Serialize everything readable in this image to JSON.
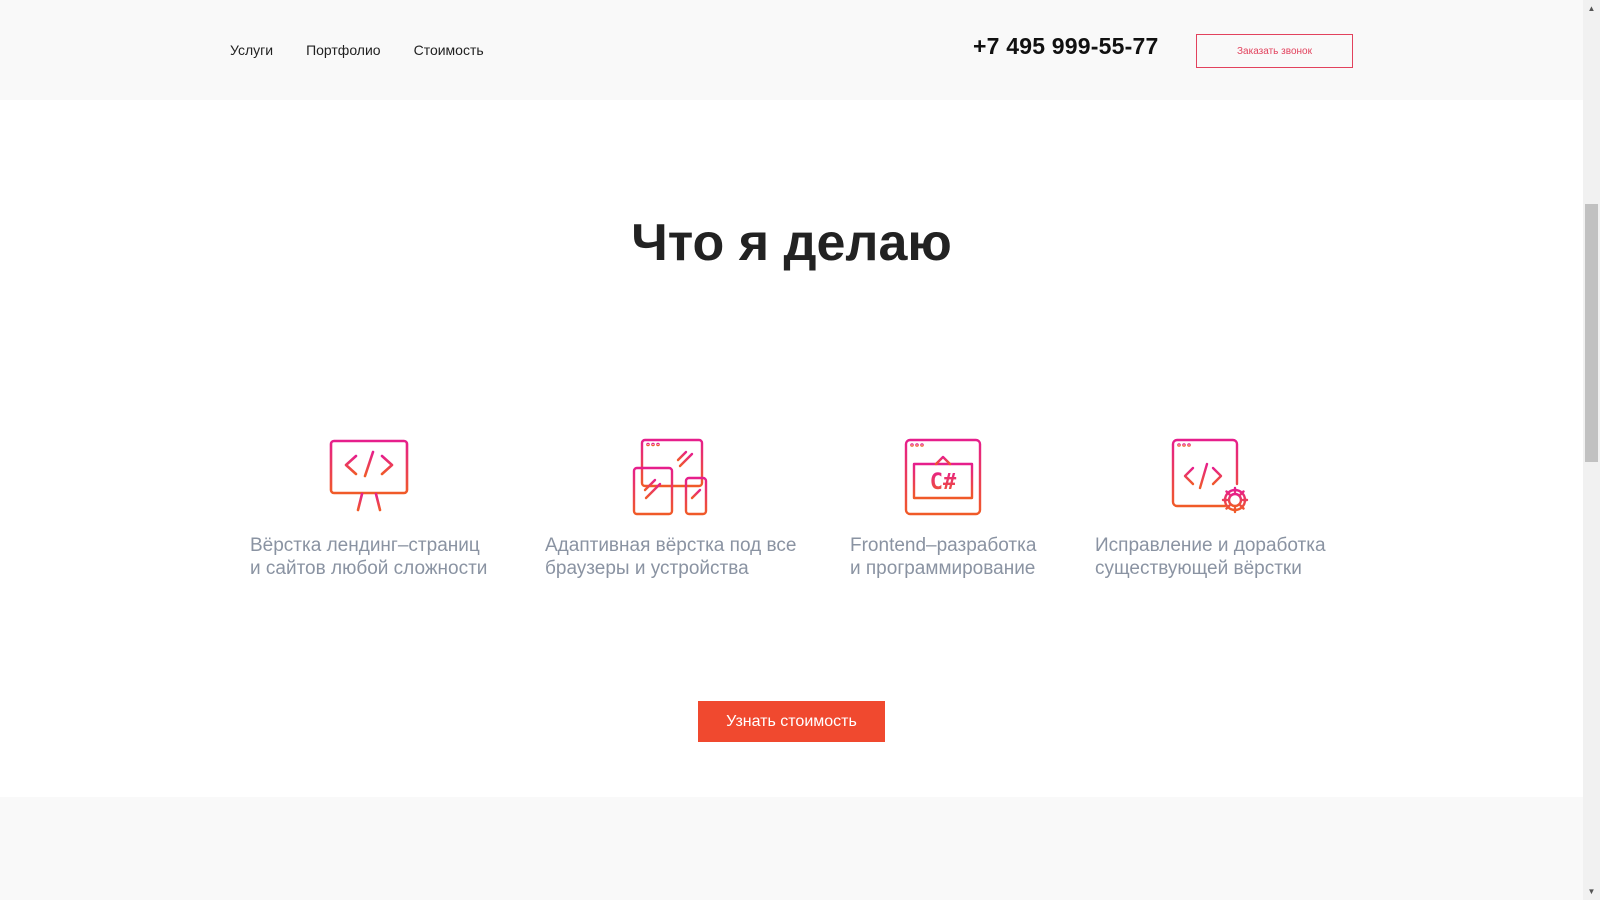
{
  "header": {
    "nav": [
      {
        "label": "Услуги"
      },
      {
        "label": "Портфолио"
      },
      {
        "label": "Стоимость"
      }
    ],
    "phone": "+7 495 999-55-77",
    "call_button": "Заказать звонок"
  },
  "section": {
    "title": "Что я делаю",
    "services": [
      {
        "icon": "monitor-code-icon",
        "line1": "Вёрстка лендинг–страниц",
        "line2": "и сайтов любой сложности"
      },
      {
        "icon": "responsive-devices-icon",
        "line1": "Адаптивная вёрстка под все",
        "line2": "браузеры и устройства"
      },
      {
        "icon": "csharp-window-icon",
        "line1": "Frontend–разработка",
        "line2": "и программирование"
      },
      {
        "icon": "code-window-gear-icon",
        "line1": "Исправление и доработка",
        "line2": "существующей вёрстки"
      }
    ],
    "cta_button": "Узнать стоимость"
  },
  "colors": {
    "accent_pink": "#e61e8c",
    "accent_orange": "#f05a28",
    "cta_bg": "#f0492f",
    "text_muted": "#8a93a2",
    "header_bg": "#f9f9f9"
  },
  "scrollbar": {
    "up": "▲",
    "down": "▼"
  }
}
